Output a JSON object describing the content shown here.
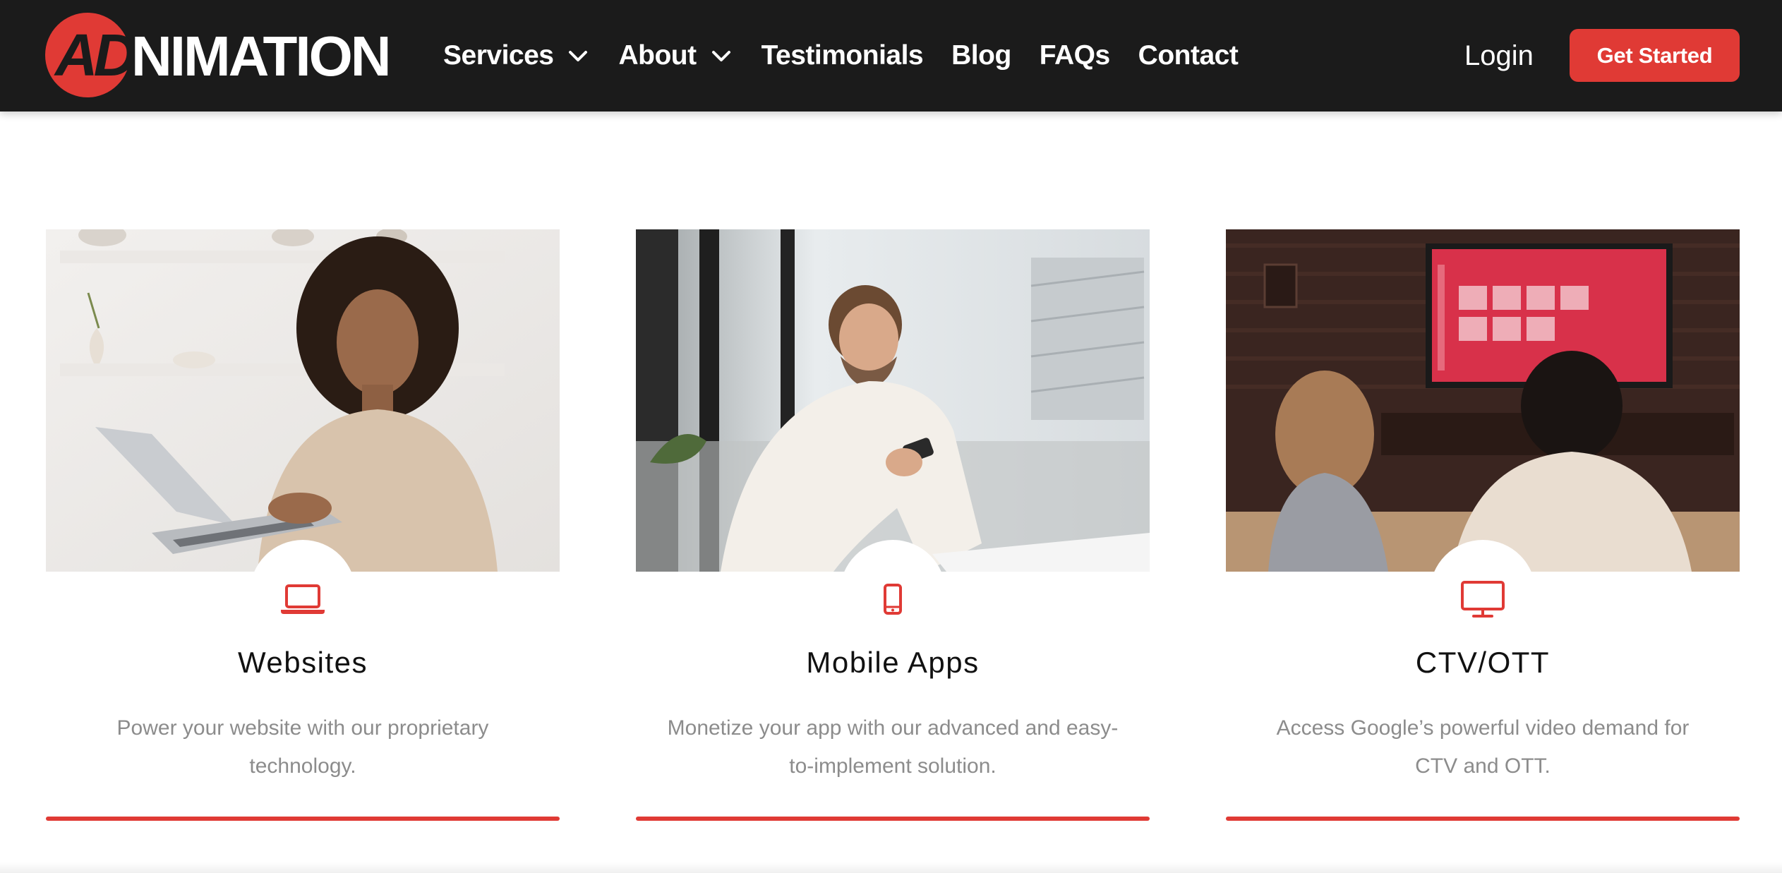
{
  "brand": {
    "logo_ad": "AD",
    "logo_rest": "NIMATION",
    "accent_color": "#e03a35",
    "header_bg": "#1b1b1b"
  },
  "nav": {
    "items": [
      {
        "label": "Services",
        "has_dropdown": true
      },
      {
        "label": "About",
        "has_dropdown": true
      },
      {
        "label": "Testimonials",
        "has_dropdown": false
      },
      {
        "label": "Blog",
        "has_dropdown": false
      },
      {
        "label": "FAQs",
        "has_dropdown": false
      },
      {
        "label": "Contact",
        "has_dropdown": false
      }
    ],
    "login": "Login",
    "cta": "Get Started"
  },
  "cards": [
    {
      "icon": "laptop-icon",
      "title": "Websites",
      "description": "Power your website with our proprietary technology."
    },
    {
      "icon": "mobile-phone-icon",
      "title": "Mobile Apps",
      "description": "Monetize your app with our advanced and easy-to-implement solution."
    },
    {
      "icon": "monitor-icon",
      "title": "CTV/OTT",
      "description": "Access Google’s powerful video demand for CTV and OTT."
    }
  ]
}
